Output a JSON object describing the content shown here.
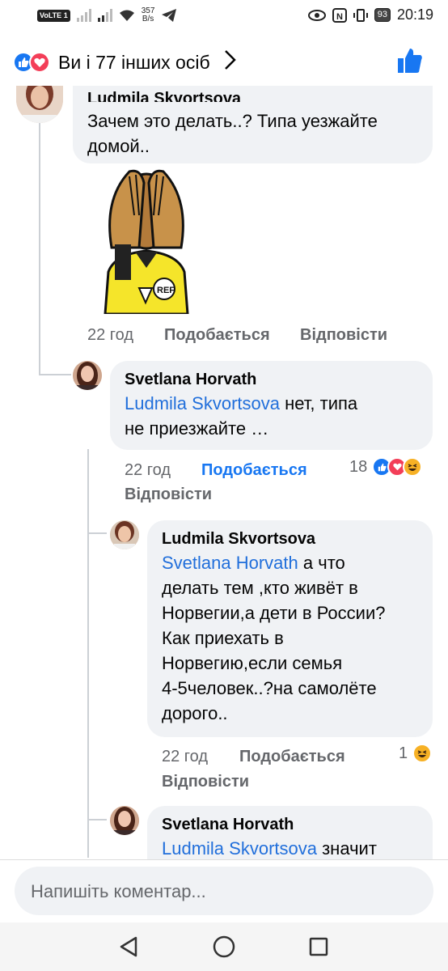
{
  "status_bar": {
    "volte": "VoLTE",
    "sim": "1",
    "speed_value": "357",
    "speed_unit": "B/s",
    "battery": "93",
    "time": "20:19"
  },
  "reactions_header": {
    "summary": "Ви і 77 інших осіб"
  },
  "comments": [
    {
      "author": "Ludmila Skvortsova",
      "text_line1": "Зачем это делать..? Типа уезжайте",
      "text_line2": "домой..",
      "sticker_label": "REF",
      "time": "22 год",
      "like": "Подобається",
      "reply": "Відповісти"
    },
    {
      "author": "Svetlana Horvath",
      "mention": "Ludmila Skvortsova",
      "text_line1": " нет, типа",
      "text_line2": "не приезжайте …",
      "time": "22 год",
      "like": "Подобається",
      "reply": "Відповісти",
      "reaction_count": "18"
    },
    {
      "author": "Ludmila Skvortsova",
      "mention": "Svetlana Horvath",
      "text_line1": " а что",
      "text_line2": "делать тем ,кто живёт в",
      "text_line3": "Норвегии,а дети в России?",
      "text_line4": "Как приехать в",
      "text_line5": "Норвегию,если семья",
      "text_line6": "4-5человек..?на самолёте",
      "text_line7": "дорого..",
      "time": "22 год",
      "like": "Подобається",
      "reply": "Відповісти",
      "reaction_count": "1"
    },
    {
      "author": "Svetlana Horvath",
      "mention": "Ludmila Skvortsova",
      "text_line1": " значит"
    }
  ],
  "composer": {
    "placeholder": "Напишіть коментар..."
  },
  "colors": {
    "accent": "#1877f2",
    "mention": "#216fdb",
    "bubble": "#f0f2f5",
    "love": "#f33e58"
  }
}
